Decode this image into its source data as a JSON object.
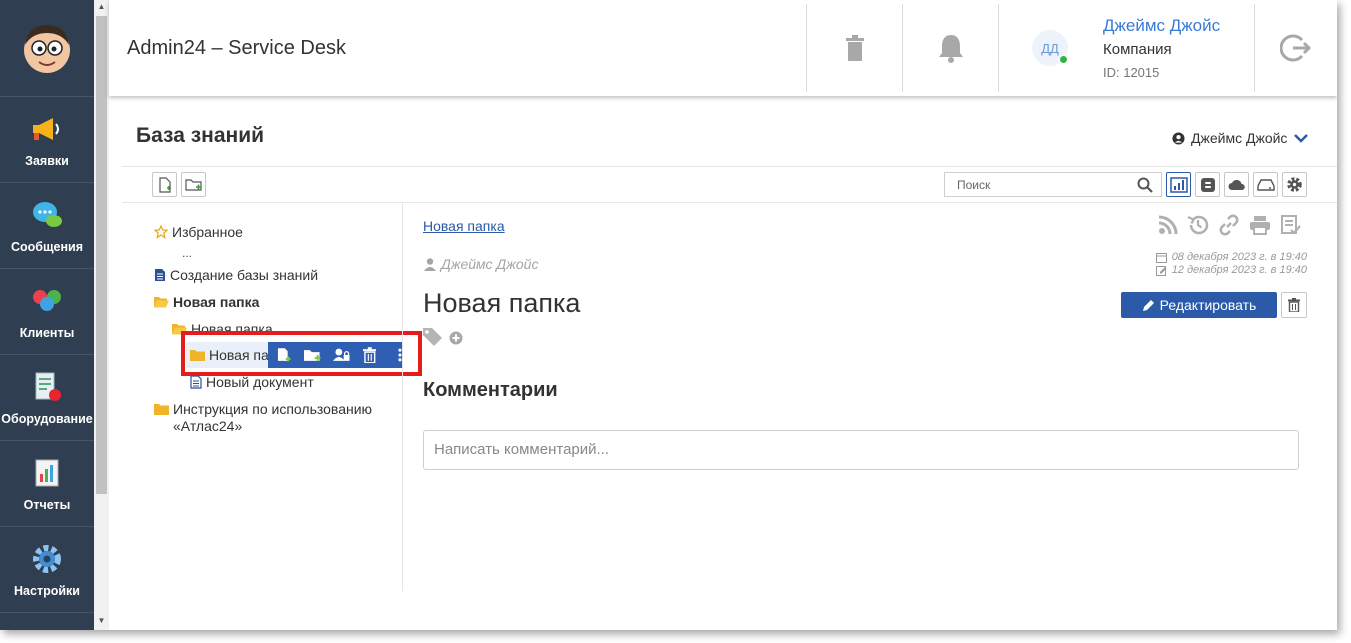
{
  "sidebar": {
    "items": [
      {
        "label": "Заявки",
        "icon": "megaphone-icon"
      },
      {
        "label": "Сообщения",
        "icon": "chat-icon"
      },
      {
        "label": "Клиенты",
        "icon": "clients-icon"
      },
      {
        "label": "Оборудование",
        "icon": "equipment-icon"
      },
      {
        "label": "Отчеты",
        "icon": "report-icon"
      },
      {
        "label": "Настройки",
        "icon": "gear-icon"
      }
    ]
  },
  "header": {
    "title": "Admin24 – Service Desk",
    "user": {
      "initials": "ДД",
      "name": "Джеймс Джойс",
      "company": "Компания",
      "id": "ID: 12015"
    }
  },
  "page": {
    "title": "База знаний",
    "author_selector": "Джеймс Джойс",
    "search_placeholder": "Поиск"
  },
  "tree": {
    "favorites": "Избранное",
    "ellipsis": "...",
    "doc_create": "Создание базы знаний",
    "folder_new": "Новая папка",
    "folder_sub": "Новая папка",
    "folder_selected": "Новая пап",
    "doc_new": "Новый документ",
    "folder_guide_1": "Инструкция по использованию",
    "folder_guide_2": "«Атлас24»"
  },
  "content": {
    "breadcrumb": "Новая папка",
    "author": "Джеймс Джойс",
    "created": "08 декабря 2023 г. в 19:40",
    "modified": "12 декабря 2023 г. в 19:40",
    "title": "Новая папка",
    "edit_label": "Редактировать",
    "comments_heading": "Комментарии",
    "comment_placeholder": "Написать комментарий..."
  },
  "colors": {
    "sidebar": "#2f3e50",
    "accent": "#2b5aa8",
    "highlight": "#e41c1c",
    "online": "#2fb344"
  }
}
